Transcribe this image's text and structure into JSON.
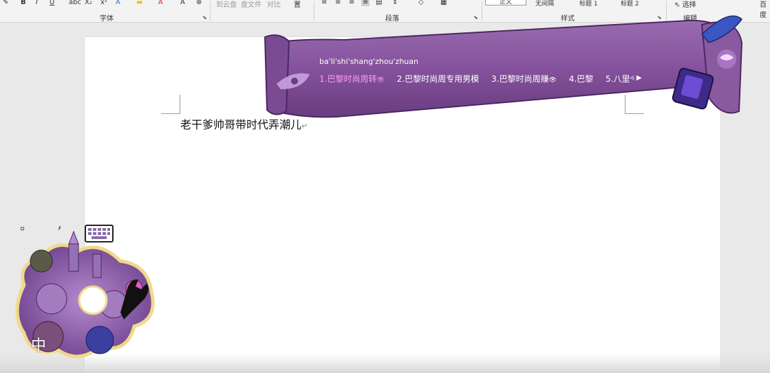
{
  "ribbon": {
    "font_group_label": "字体",
    "cloud_items": [
      "到云盘",
      "盘文件",
      "对比",
      "置"
    ],
    "paragraph_group_label": "段落",
    "styles_group_label": "样式",
    "style_items": [
      "正文",
      "无间隔",
      "标题 1",
      "标题 2"
    ],
    "select_label": "选择",
    "edit_group_label": "编辑",
    "right_cut_label": "百度"
  },
  "document": {
    "body_text": "老干爹帅哥带时代弄潮儿",
    "para_mark": "↵"
  },
  "ime": {
    "pinyin_input": "ba'li'shi'shang'zhou'zhuan",
    "candidates": [
      {
        "label": "1.巴黎时尚周转",
        "selected": true,
        "has_eye": true
      },
      {
        "label": "2.巴黎时尚周专用男模",
        "selected": false,
        "has_eye": false
      },
      {
        "label": "3.巴黎时尚周赚",
        "selected": false,
        "has_eye": true
      },
      {
        "label": "4.巴黎",
        "selected": false,
        "has_eye": false
      },
      {
        "label": "5.八里",
        "selected": false,
        "has_eye": false
      }
    ],
    "eye_glyph": "👁",
    "prev_arrow": "◀",
    "next_arrow": "▶",
    "status_lang": "中",
    "status_punct_1": "°",
    "status_punct_2": "’",
    "colors": {
      "banner": "#8a5aa0",
      "banner_dark": "#5e3470",
      "selected_candidate": "#ff9cf5"
    }
  }
}
